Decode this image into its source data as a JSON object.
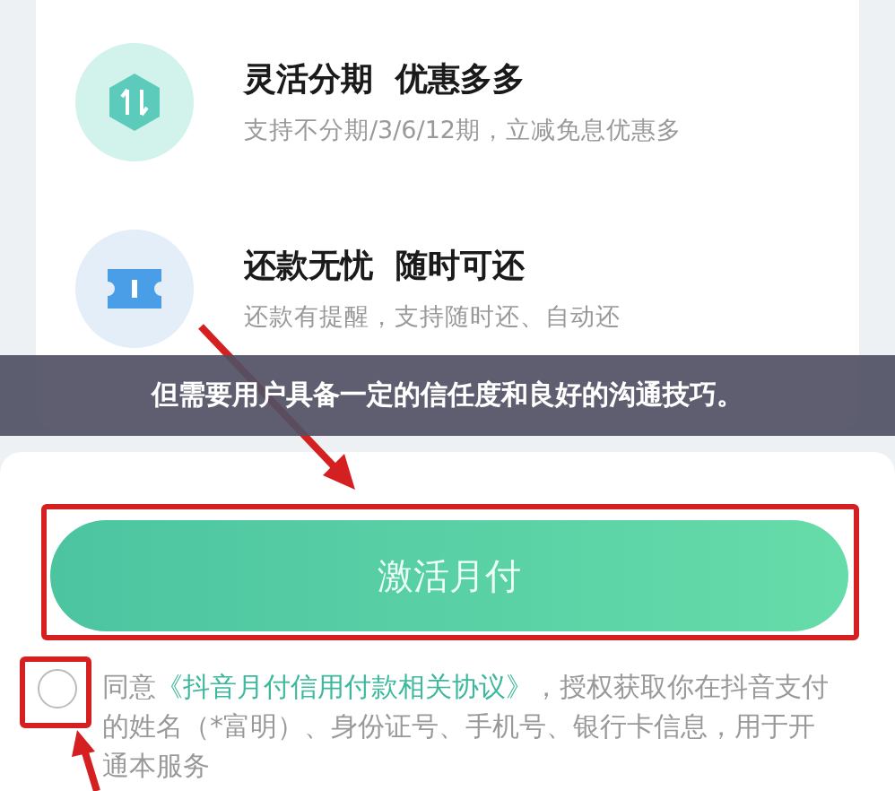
{
  "features": [
    {
      "title": "灵活分期  优惠多多",
      "subtitle": "支持不分期/3/6/12期，立减免息优惠多"
    },
    {
      "title": "还款无忧  随时可还",
      "subtitle": "还款有提醒，支持随时还、自动还"
    }
  ],
  "caption": "但需要用户具备一定的信任度和良好的沟通技巧。",
  "activate_button": "激活月付",
  "agreement": {
    "checked": false,
    "prefix": "同意",
    "link": "《抖音月付信用付款相关协议》",
    "suffix": "，授权获取你在抖音支付的姓名（*富明）、身份证号、手机号、银行卡信息，用于开通本服务"
  }
}
